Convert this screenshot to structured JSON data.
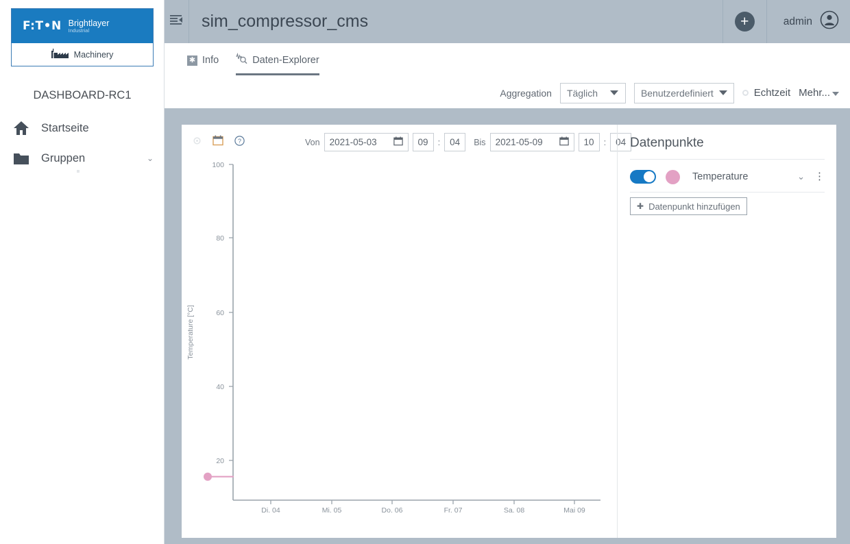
{
  "sidebar": {
    "logo": {
      "brand_mark": "F:T•N",
      "brand_name": "Brightlayer",
      "brand_sub": "Industrial",
      "product": "Machinery",
      "brand_color": "#1a7bc0"
    },
    "dashboard_title": "DASHBOARD-RC1",
    "items": [
      {
        "label": "Startseite",
        "icon": "home-icon",
        "chevron": ""
      },
      {
        "label": "Gruppen",
        "icon": "folder-icon",
        "chevron": "⌄"
      }
    ]
  },
  "header": {
    "menu_icon": "collapse-menu-icon",
    "title": "sim_compressor_cms",
    "add_icon": "plus-icon",
    "user_name": "admin",
    "user_icon": "user-avatar-icon",
    "background": "#b0bcc7"
  },
  "tabs": [
    {
      "label": "Info",
      "icon": "info-square-icon",
      "active": false
    },
    {
      "label": "Daten-Explorer",
      "icon": "data-explorer-icon",
      "active": true
    }
  ],
  "controlbar": {
    "aggregation_label": "Aggregation",
    "aggregation_value": "Täglich",
    "range_value": "Benutzerdefiniert",
    "realtime_label": "Echtzeit",
    "realtime_enabled": false,
    "more_label": "Mehr...",
    "caret_icon": "chevron-down-icon"
  },
  "chart_panel": {
    "toolbar_icons": [
      "settings-gear-icon",
      "calendar-icon",
      "help-circle-icon"
    ],
    "date_range": {
      "from_label": "Von",
      "from_date": "2021-05-03",
      "from_hour": "09",
      "from_minute": "04",
      "to_label": "Bis",
      "to_date": "2021-05-09",
      "to_hour": "10",
      "to_minute": "04",
      "separator": ":",
      "calendar_icon": "calendar-icon"
    }
  },
  "datapoints": {
    "title": "Datenpunkte",
    "rows": [
      {
        "name": "Temperature",
        "enabled": true,
        "color": "#e3a1c4",
        "chevron_icon": "chevron-down-icon",
        "menu_icon": "kebab-menu-icon"
      }
    ],
    "add_button": {
      "label": "Datenpunkt hinzufügen",
      "icon": "plus-circle-icon"
    }
  },
  "chart_data": {
    "type": "line",
    "title": "",
    "xlabel": "",
    "ylabel": "Temperature [°C]",
    "ylim": [
      0,
      100
    ],
    "yticks": [
      20,
      40,
      60,
      80,
      100
    ],
    "xticks": [
      "Di. 04",
      "Mi. 05",
      "Do. 06",
      "Fr. 07",
      "Sa. 08",
      "Mai 09"
    ],
    "grid": false,
    "legend": "none",
    "series": [
      {
        "name": "Temperature",
        "color": "#e3a1c4",
        "points": [
          {
            "x": "2021-05-03 09:04",
            "y": 7
          }
        ]
      }
    ]
  }
}
